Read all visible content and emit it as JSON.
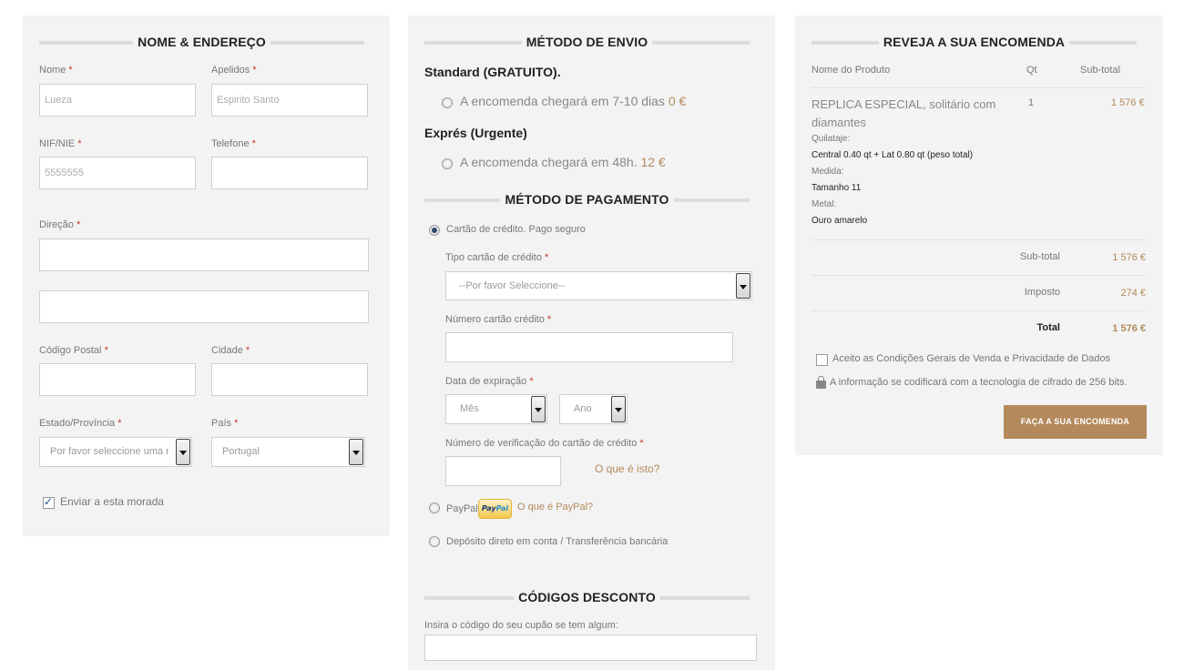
{
  "address": {
    "title": "NOME & ENDEREÇO",
    "required_mark": "*",
    "first_name": {
      "label": "Nome",
      "value": "Lueza"
    },
    "last_name": {
      "label": "Apelidos",
      "value": "Espirito Santo"
    },
    "nif": {
      "label": "NIF/NIE",
      "value": "5555555"
    },
    "phone": {
      "label": "Telefone",
      "value": ""
    },
    "address": {
      "label": "Direção",
      "line1": "",
      "line2": ""
    },
    "postal_code": {
      "label": "Código Postal",
      "value": ""
    },
    "city": {
      "label": "Cidade",
      "value": ""
    },
    "state": {
      "label": "Estado/Província",
      "selected": "Por favor seleccione uma r"
    },
    "country": {
      "label": "País",
      "selected": "Portugal"
    },
    "ship_here": {
      "label": "Enviar a esta morada",
      "checked": true
    }
  },
  "shipping": {
    "title": "MÉTODO DE ENVIO",
    "standard": {
      "title": "Standard (GRATUITO).",
      "text": "A encomenda chegará em 7-10 dias",
      "price": "0 €"
    },
    "express": {
      "title": "Exprés (Urgente)",
      "text": "A encomenda chegará em 48h.",
      "price": "12 €"
    }
  },
  "payment": {
    "title": "MÉTODO DE PAGAMENTO",
    "card": {
      "option_label": "Cartão de crédito. Pago seguro",
      "selected": true,
      "type_label": "Tipo cartão de crédito",
      "type_selected": "--Por favor Seleccione--",
      "number_label": "Número cartão crédito",
      "expiry_label": "Data de expiração",
      "month": "Mês",
      "year": "Ano",
      "cvv_label": "Número de verificação do cartão de crédito",
      "cvv_help": "O que é isto?"
    },
    "paypal": {
      "label": "PayPal",
      "logo_1": "Pay",
      "logo_2": "Pal",
      "help": "O que é PayPal?"
    },
    "transfer": {
      "label": "Depósito direto em conta / Transferência bancária"
    }
  },
  "discount": {
    "title": "CÓDIGOS DESCONTO",
    "label": "Insira o código do seu cupão se tem algum:",
    "value": ""
  },
  "review": {
    "title": "REVEJA A SUA ENCOMENDA",
    "columns": {
      "product": "Nome do Produto",
      "qty": "Qt",
      "subtotal": "Sub-total"
    },
    "item": {
      "name": "REPLICA ESPECIAL, solitário com diamantes",
      "qty": "1",
      "price": "1 576 €",
      "carat_label": "Quilataje:",
      "carat_value": "Central 0.40 qt + Lat 0.80 qt (peso total)",
      "size_label": "Medida:",
      "size_value": "Tamanho 11",
      "metal_label": "Metal:",
      "metal_value": "Ouro amarelo"
    },
    "subtotal": {
      "label": "Sub-total",
      "value": "1 576 €"
    },
    "tax": {
      "label": "Imposto",
      "value": "274 €"
    },
    "total": {
      "label": "Total",
      "value": "1 576 €"
    },
    "terms": {
      "label": "Aceito as Condições Gerais de Venda e Privacidade de Dados",
      "checked": false
    },
    "security": "A informação se codificará com a tecnologia de cifrado de 256 bits.",
    "submit": "FAÇA A SUA ENCOMENDA"
  },
  "colors": {
    "accent": "#b48a5c",
    "panel": "#f3f3f3",
    "required": "#c0392b"
  }
}
